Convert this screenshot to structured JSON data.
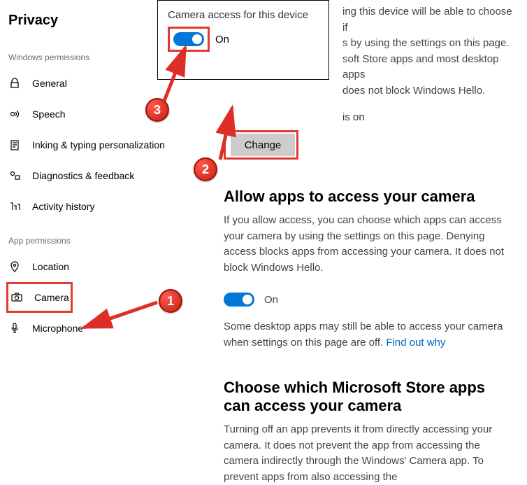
{
  "sidebar": {
    "title": "Privacy",
    "winperm_header": "Windows permissions",
    "appperm_header": "App permissions",
    "items": {
      "general": "General",
      "speech": "Speech",
      "inking": "Inking & typing personalization",
      "diagnostics": "Diagnostics & feedback",
      "activity": "Activity history",
      "location": "Location",
      "camera": "Camera",
      "microphone": "Microphone"
    }
  },
  "main": {
    "partial_top_l1": "ing this device will be able to choose if",
    "partial_top_l2": "s by using the settings on this page.",
    "partial_top_l3": "soft Store apps and most desktop apps",
    "partial_top_l4": "does not block Windows Hello.",
    "device_on": "is on",
    "change_btn": "Change",
    "allow_heading": "Allow apps to access your camera",
    "allow_body": "If you allow access, you can choose which apps can access your camera by using the settings on this page. Denying access blocks apps from accessing your camera. It does not block Windows Hello.",
    "toggle_on": "On",
    "desktop_note": "Some desktop apps may still be able to access your camera when settings on this page are off. ",
    "find_out": "Find out why",
    "choose_heading": "Choose which Microsoft Store apps can access your camera",
    "choose_body": "Turning off an app prevents it from directly accessing your camera. It does not prevent the app from accessing the camera indirectly through the Windows' Camera app. To prevent apps from also accessing the"
  },
  "flyout": {
    "title": "Camera access for this device",
    "toggle_label": "On"
  },
  "ann": {
    "b1": "1",
    "b2": "2",
    "b3": "3"
  }
}
